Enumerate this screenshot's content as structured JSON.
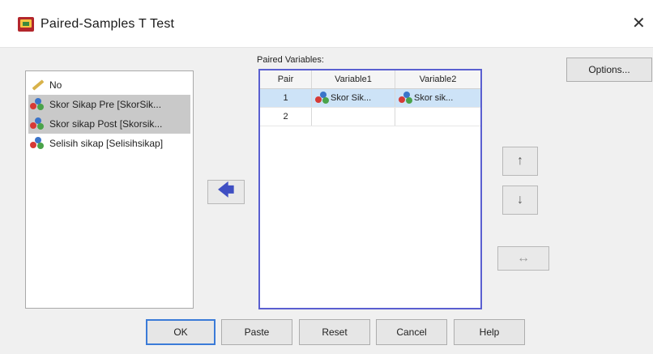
{
  "window": {
    "title": "Paired-Samples T Test",
    "close_glyph": "✕"
  },
  "source_list": {
    "items": [
      {
        "label": "No",
        "icon": "ruler-pencil-icon",
        "selected": false
      },
      {
        "label": "Skor Sikap Pre [SkorSik...",
        "icon": "scale-variable-icon",
        "selected": true
      },
      {
        "label": "Skor sikap Post [Skorsik...",
        "icon": "scale-variable-icon",
        "selected": true
      },
      {
        "label": "Selisih sikap [Selisihsikap]",
        "icon": "scale-variable-icon",
        "selected": false
      }
    ]
  },
  "paired": {
    "label": "Paired Variables:",
    "columns": [
      "Pair",
      "Variable1",
      "Variable2"
    ],
    "rows": [
      {
        "pair": "1",
        "var1": "Skor Sik...",
        "var2": "Skor sik..."
      },
      {
        "pair": "2",
        "var1": "",
        "var2": ""
      }
    ]
  },
  "buttons": {
    "options": "Options...",
    "ok": "OK",
    "paste": "Paste",
    "reset": "Reset",
    "cancel": "Cancel",
    "help": "Help"
  },
  "arrows": {
    "move": "🡄",
    "up": "↑",
    "down": "↓",
    "swap": "↔"
  },
  "colors": {
    "selection": "#cde3f7",
    "table_border": "#5a5fd0",
    "default_button_border": "#3b7bd8"
  }
}
